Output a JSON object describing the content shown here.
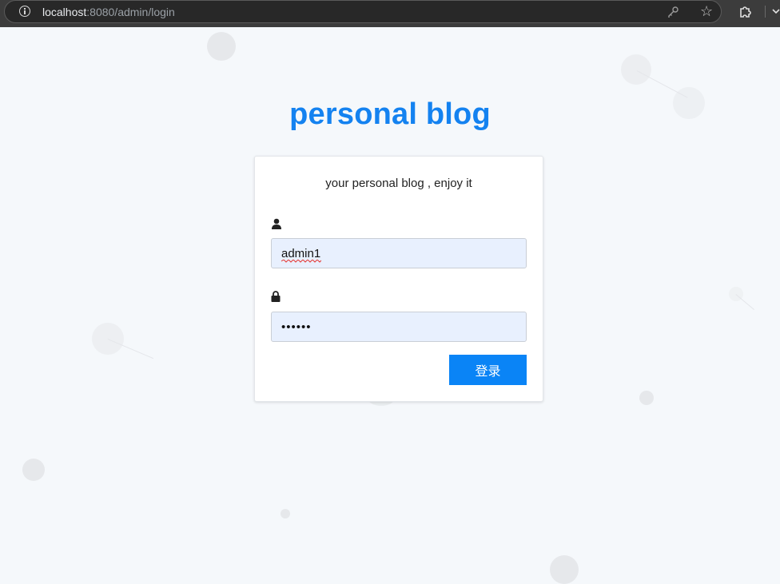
{
  "browser": {
    "url_host": "localhost",
    "url_path": ":8080/admin/login",
    "icons": [
      "info-icon",
      "key-icon",
      "star-icon",
      "extensions-icon",
      "chevron-down-icon"
    ]
  },
  "page": {
    "title": "personal blog",
    "title_color": "#1482f0"
  },
  "login": {
    "subtitle": "your personal blog , enjoy it",
    "username_icon": "user-icon",
    "password_icon": "lock-icon",
    "username_value": "admin1",
    "password_value": "••••••",
    "submit_label": "登录",
    "submit_color": "#0a84f6"
  }
}
